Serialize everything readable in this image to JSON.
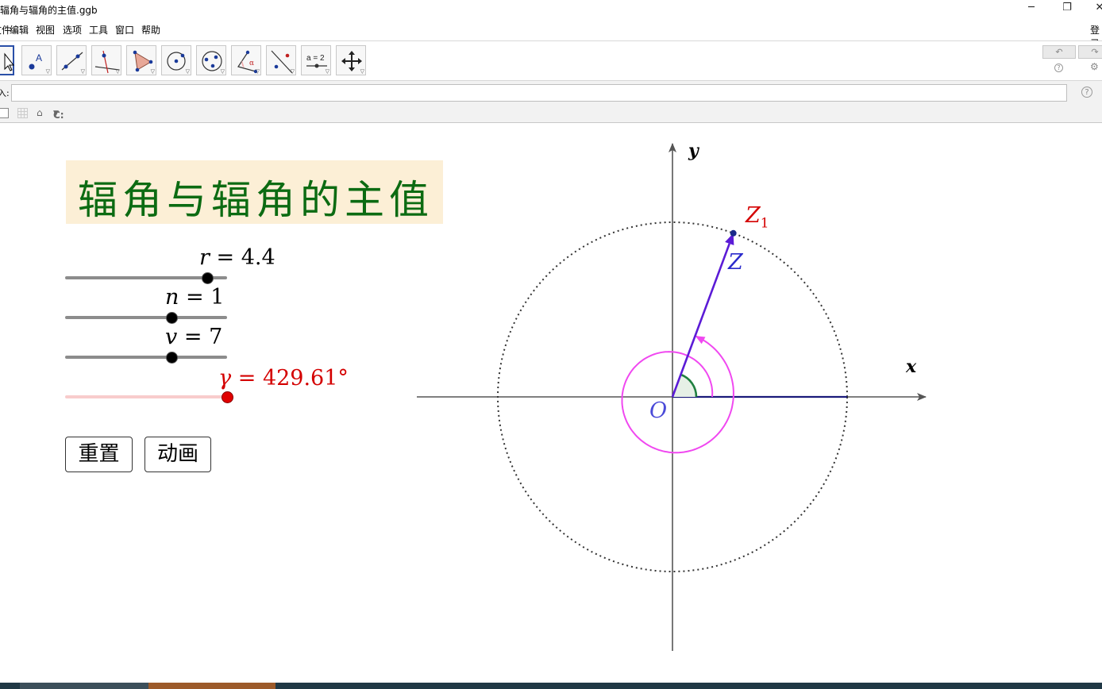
{
  "window": {
    "title": "辐角与辐角的主值.ggb",
    "minimize": "─",
    "restore": "❐",
    "close": "✕"
  },
  "menu": {
    "items": [
      "文件",
      "编辑",
      "视图",
      "选项",
      "工具",
      "窗口",
      "帮助"
    ],
    "login": "登录"
  },
  "toolbar": {
    "tools": [
      "move",
      "point",
      "line",
      "perpendicular",
      "polygon",
      "circle",
      "conic",
      "angle",
      "reflect",
      "slider",
      "move-graphics"
    ],
    "slider_tool_text": "a = 2",
    "undo_icon": "↶",
    "redo_icon": "↷",
    "help_icon": "?",
    "settings_icon": "⚙"
  },
  "inputbar": {
    "label": "输入:",
    "value": "",
    "help": "?"
  },
  "stylebar": {
    "home_icon": "⌂",
    "c_label": "C:"
  },
  "title": "辐角与辐角的主值",
  "sliders": [
    {
      "name": "r",
      "value_text": "4.4",
      "fraction": 0.88
    },
    {
      "name": "n",
      "value_text": "1",
      "fraction": 0.66
    },
    {
      "name": "v",
      "value_text": "7",
      "fraction": 0.66
    },
    {
      "name": "γ",
      "value_text": "429.61°",
      "fraction": 1.0
    }
  ],
  "buttons": {
    "reset": "重置",
    "animate": "动画"
  },
  "graph": {
    "x_axis": "x",
    "y_axis": "y",
    "origin": "O",
    "vector": "Z",
    "point": "Z",
    "point_subscript": "1",
    "r": 4.4,
    "angle_deg": 429.61,
    "colors": {
      "vector": "#5b1bd6",
      "circle": "#f048f0",
      "point_label": "#d40000",
      "vector_label": "#2a2acc",
      "arc": "#208040",
      "gamma": "#d40000",
      "title": "#0c6b12"
    }
  }
}
